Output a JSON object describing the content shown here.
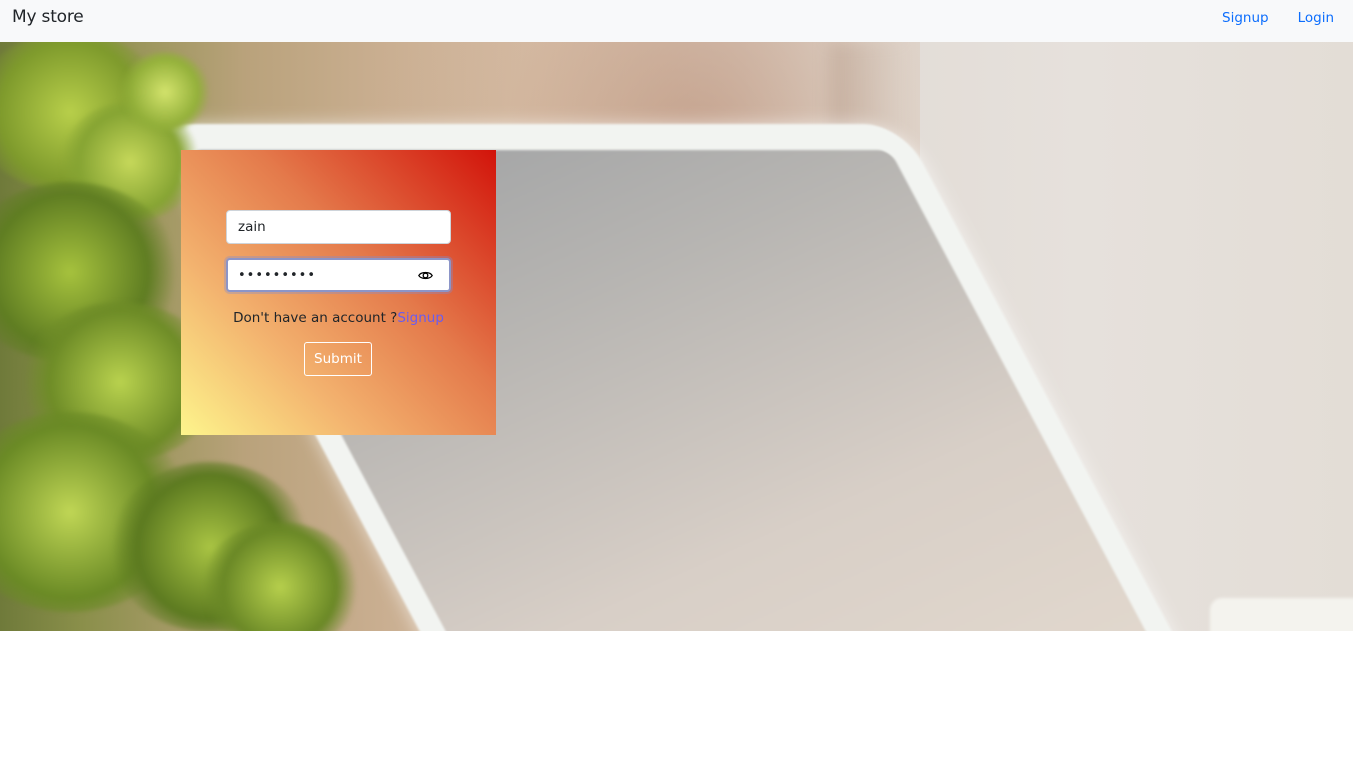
{
  "navbar": {
    "brand": "My store",
    "links": [
      {
        "label": "Signup"
      },
      {
        "label": "Login"
      }
    ]
  },
  "login_form": {
    "username_value": "zain",
    "password_masked": "•••••••••",
    "account_prompt": "Don't have an account ?",
    "signup_link": "Signup",
    "submit_label": "Submit"
  },
  "colors": {
    "navbar_bg": "#f8f9fa",
    "link_blue": "#0d6efd",
    "card_gradient_start": "#fdf58c",
    "card_gradient_end": "#d2130a",
    "signup_link_color": "#6a5cf0"
  },
  "icons": {
    "password_toggle": "eye-icon"
  }
}
